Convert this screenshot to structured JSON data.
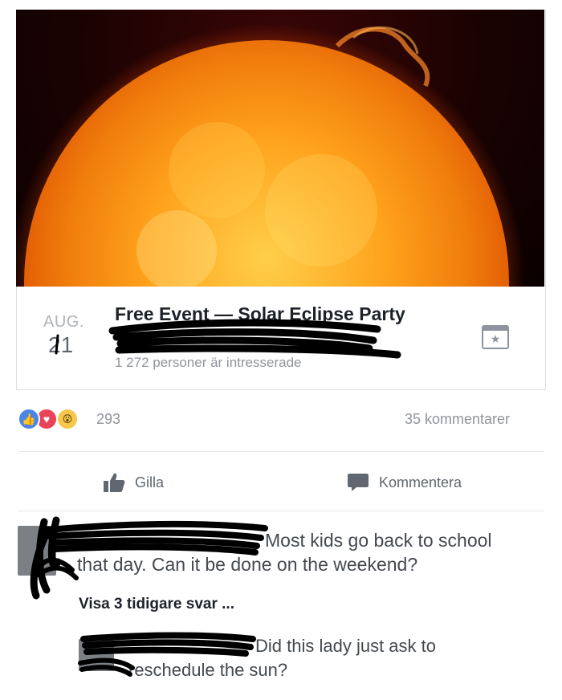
{
  "event": {
    "month": "AUG.",
    "day": "21",
    "title": "Free Event — Solar Eclipse Party",
    "interested": "1 272 personer är intresserade",
    "image": "sun-photo",
    "save_icon": "star-calendar-icon"
  },
  "stats": {
    "reaction_icons": [
      "like-icon",
      "love-icon",
      "wow-icon"
    ],
    "reaction_count": "293",
    "comment_count": "35 kommentarer"
  },
  "actions": {
    "like_label": "Gilla",
    "comment_label": "Kommentera"
  },
  "comments": {
    "first": {
      "text_line1": "Most kids go back to school",
      "text_line2": "that day. Can it be done on the weekend?"
    },
    "view_replies": "Visa 3 tidigare svar ...",
    "reply": {
      "text_line1": "Did this lady just ask to",
      "text_line2": "reschedule the sun?"
    }
  },
  "colors": {
    "facebook_blue": "#4a86e8",
    "love_red": "#e9435a",
    "wow_yellow": "#f7c64b",
    "redaction": "#000000"
  }
}
